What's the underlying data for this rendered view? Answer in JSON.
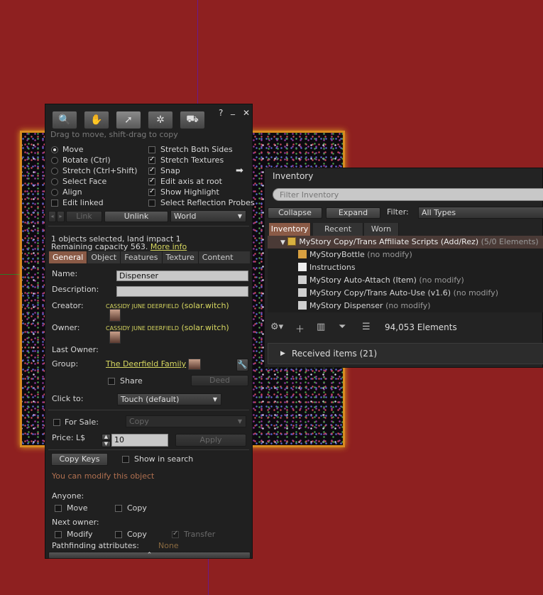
{
  "build": {
    "help": "?",
    "minimize": "_",
    "close": "✕",
    "hint": "Drag to move, shift-drag to copy",
    "modes": [
      {
        "label": "Move",
        "on": true
      },
      {
        "label": "Rotate (Ctrl)",
        "on": false
      },
      {
        "label": "Stretch (Ctrl+Shift)",
        "on": false
      },
      {
        "label": "Select Face",
        "on": false
      },
      {
        "label": "Align",
        "on": false
      }
    ],
    "edit_linked": "Edit linked",
    "options": [
      {
        "label": "Stretch Both Sides",
        "on": false
      },
      {
        "label": "Stretch Textures",
        "on": true
      },
      {
        "label": "Snap",
        "on": true
      },
      {
        "label": "Edit axis at root",
        "on": true
      },
      {
        "label": "Show Highlight",
        "on": true
      },
      {
        "label": "Select Reflection Probes",
        "on": false
      }
    ],
    "link_label": "Link",
    "unlink_label": "Unlink",
    "ruler": "World",
    "selection_info": "1 objects selected, land impact 1",
    "remaining": "Remaining capacity 563.",
    "more_info": "More info",
    "tabs": [
      "General",
      "Object",
      "Features",
      "Texture",
      "Content"
    ],
    "name_label": "Name:",
    "name_value": "Dispenser",
    "description_label": "Description:",
    "creator_label": "Creator:",
    "creator_name": "CASSIDY JUNE DEERFIELD",
    "creator_user": "(solar.witch)",
    "owner_label": "Owner:",
    "owner_name": "CASSIDY JUNE DEERFIELD",
    "owner_user": "(solar.witch)",
    "last_owner_label": "Last Owner:",
    "group_label": "Group:",
    "group_value": "The Deerfield Family",
    "share_label": "Share",
    "deed_label": "Deed",
    "click_to_label": "Click to:",
    "click_to_value": "Touch  (default)",
    "for_sale_label": "For Sale:",
    "sale_type": "Copy",
    "price_label": "Price: L$",
    "price_value": "10",
    "apply_label": "Apply",
    "copy_keys_label": "Copy Keys",
    "show_in_search_label": "Show in search",
    "modify_notice": "You can modify this object",
    "anyone_label": "Anyone:",
    "anyone_move": "Move",
    "anyone_copy": "Copy",
    "next_owner_label": "Next owner:",
    "next_modify": "Modify",
    "next_copy": "Copy",
    "next_transfer": "Transfer",
    "pathfinding_label": "Pathfinding attributes:",
    "pathfinding_value": "None",
    "expand_chevron": "^"
  },
  "inventory": {
    "title": "Inventory",
    "search_placeholder": "Filter Inventory",
    "collapse_label": "Collapse",
    "expand_label": "Expand",
    "filter_label": "Filter:",
    "filter_value": "All Types",
    "tabs": [
      "Inventory",
      "Recent",
      "Worn"
    ],
    "folder": {
      "name": "MyStory Copy/Trans Affiliate Scripts (Add/Rez)",
      "count": "(5/0 Elements)"
    },
    "items": [
      {
        "name": "MyStoryBottle",
        "note": "(no modify)",
        "icon": "box-icon"
      },
      {
        "name": "Instructions",
        "note": "",
        "icon": "notecard-icon"
      },
      {
        "name": "MyStory Auto-Attach (Item)",
        "note": "(no modify)",
        "icon": "script-icon"
      },
      {
        "name": "MyStory Copy/Trans Auto-Use (v1.6)",
        "note": "(no modify)",
        "icon": "script-icon"
      },
      {
        "name": "MyStory Dispenser",
        "note": "(no modify)",
        "icon": "script-icon"
      }
    ],
    "element_count": "94,053 Elements",
    "received": "Received items (21)"
  },
  "colors": {
    "background": "#8e2020",
    "tab_active": "#8a5a46",
    "link": "#d8d860",
    "modify_notice": "#b07050"
  }
}
